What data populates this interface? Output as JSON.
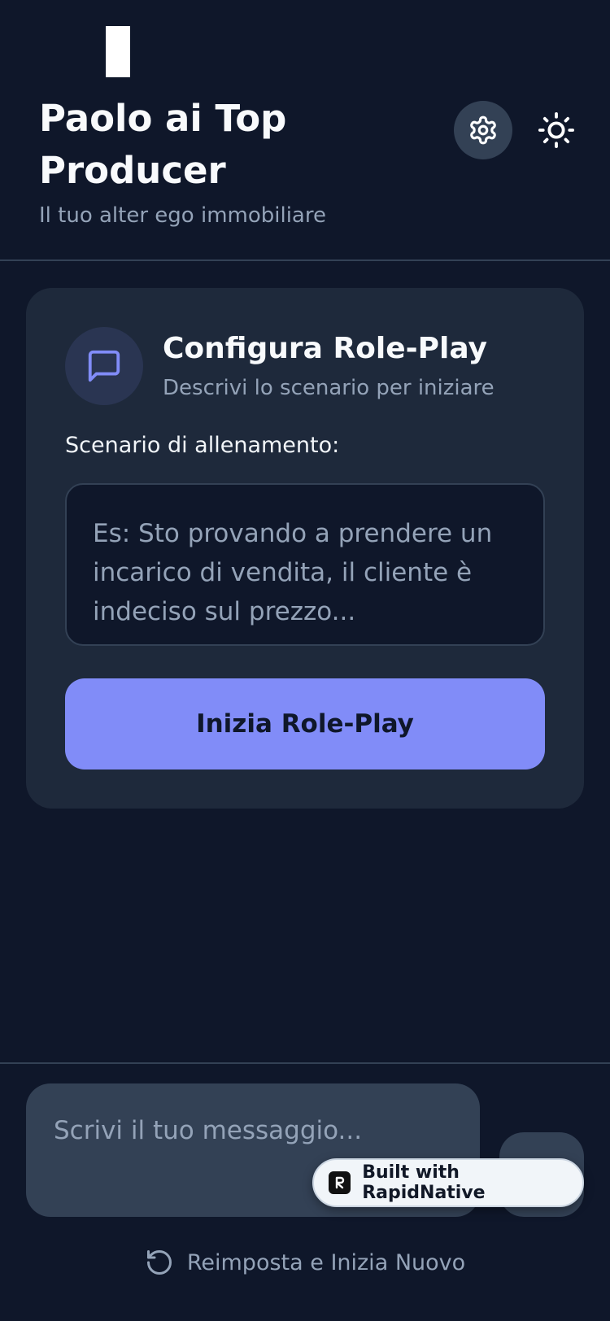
{
  "header": {
    "title": "Paolo ai Top Producer",
    "subtitle": "Il tuo alter ego immobiliare"
  },
  "card": {
    "title": "Configura Role-Play",
    "subtitle": "Descrivi lo scenario per iniziare",
    "scenario_label": "Scenario di allenamento:",
    "scenario_placeholder": "Es: Sto provando a prendere un incarico di vendita, il cliente è indeciso sul prezzo...",
    "start_button": "Inizia Role-Play"
  },
  "composer": {
    "placeholder": "Scrivi il tuo messaggio..."
  },
  "badge": {
    "label": "Built with RapidNative"
  },
  "reset": {
    "label": "Reimposta e Inizia Nuovo"
  },
  "colors": {
    "background": "#0f172a",
    "card": "#1e293b",
    "accent": "#818cf8",
    "muted_text": "#94a3b8"
  },
  "icons": [
    "gear-icon",
    "sun-icon",
    "chat-bubble-icon",
    "reset-icon",
    "rapidnative-logo-icon"
  ]
}
